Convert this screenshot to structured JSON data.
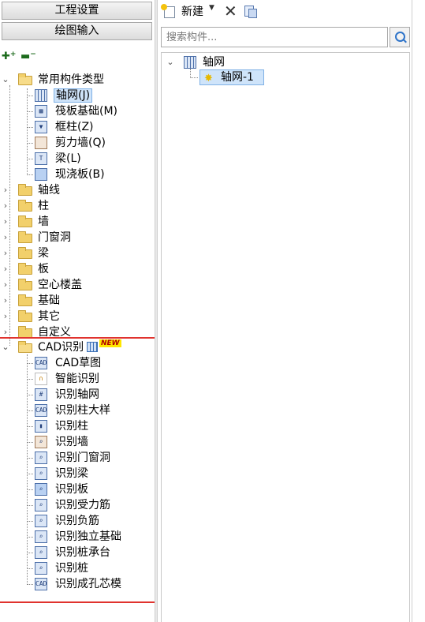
{
  "left_panel": {
    "mode_buttons": {
      "project_settings": "工程设置",
      "drawing_input": "绘图输入"
    },
    "toolbar": {
      "expand_all": "+",
      "collapse_all": "−"
    },
    "tree": {
      "common_types": {
        "label": "常用构件类型",
        "items": [
          {
            "label": "轴网(J)",
            "icon": "grid-icon"
          },
          {
            "label": "筏板基础(M)",
            "icon": "raft-icon"
          },
          {
            "label": "框柱(Z)",
            "icon": "column-icon"
          },
          {
            "label": "剪力墙(Q)",
            "icon": "wall-icon"
          },
          {
            "label": "梁(L)",
            "icon": "beam-icon"
          },
          {
            "label": "现浇板(B)",
            "icon": "slab-icon"
          }
        ]
      },
      "folders": [
        "轴线",
        "柱",
        "墙",
        "门窗洞",
        "梁",
        "板",
        "空心楼盖",
        "基础",
        "其它",
        "自定义"
      ],
      "cad_recognition": {
        "label": "CAD识别",
        "badge": "NEW",
        "items": [
          {
            "label": "CAD草图",
            "icon": "cad-icon"
          },
          {
            "label": "智能识别",
            "icon": "magnet-icon"
          },
          {
            "label": "识别轴网",
            "icon": "grid-icon"
          },
          {
            "label": "识别柱大样",
            "icon": "cad-icon"
          },
          {
            "label": "识别柱",
            "icon": "column-icon"
          },
          {
            "label": "识别墙",
            "icon": "wall-icon"
          },
          {
            "label": "识别门窗洞",
            "icon": "door-window-icon"
          },
          {
            "label": "识别梁",
            "icon": "beam-icon"
          },
          {
            "label": "识别板",
            "icon": "slab-icon"
          },
          {
            "label": "识别受力筋",
            "icon": "rebar-icon"
          },
          {
            "label": "识别负筋",
            "icon": "rebar-icon"
          },
          {
            "label": "识别独立基础",
            "icon": "foundation-icon"
          },
          {
            "label": "识别桩承台",
            "icon": "pile-cap-icon"
          },
          {
            "label": "识别桩",
            "icon": "pile-icon"
          },
          {
            "label": "识别成孔芯模",
            "icon": "cad-icon"
          }
        ]
      }
    }
  },
  "right_panel": {
    "toolbar": {
      "new_label": "新建",
      "delete_symbol": "✕"
    },
    "search": {
      "placeholder": "搜索构件..."
    },
    "component_tree": {
      "root": "轴网",
      "children": [
        "轴网-1"
      ]
    }
  },
  "colors": {
    "highlight_box": "#e0332e",
    "selection": "#cfe4fa",
    "folder": "#f2d06b"
  }
}
